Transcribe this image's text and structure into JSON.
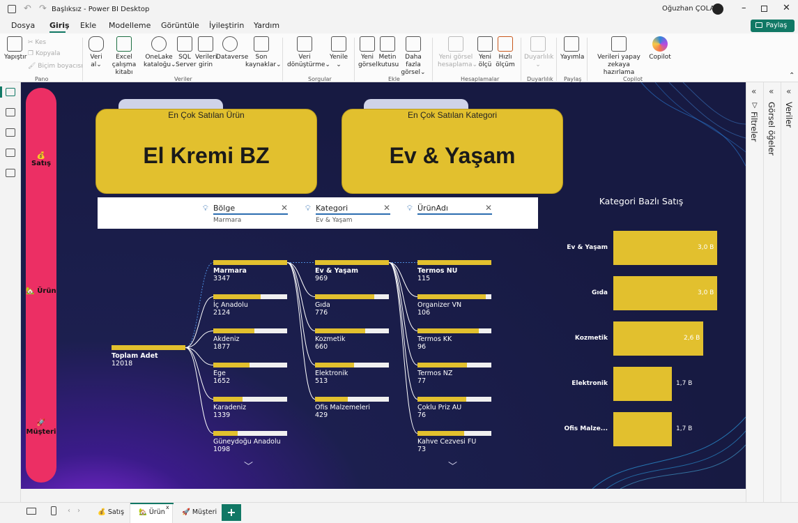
{
  "titlebar": {
    "doc_title": "Başlıksız - Power BI Desktop",
    "user": "Oğuzhan ÇOLAK"
  },
  "menu": {
    "items": [
      "Dosya",
      "Giriş",
      "Ekle",
      "Modelleme",
      "Görüntüle",
      "İyileştirin",
      "Yardım"
    ],
    "active": "Giriş",
    "share": "Paylaş"
  },
  "ribbon": {
    "paste": "Yapıştır",
    "cut": "Kes",
    "copy": "Kopyala",
    "format_painter": "Biçim boyacısı",
    "get_data_1": "Veri",
    "get_data_2": "al",
    "excel_1": "Excel çalışma",
    "excel_2": "kitabı",
    "onelake_1": "OneLake",
    "onelake_2": "kataloğu",
    "sql_1": "SQL",
    "sql_2": "Server",
    "enter_1": "Verileri",
    "enter_2": "girin",
    "dataverse": "Dataverse",
    "recent_1": "Son",
    "recent_2": "kaynaklar",
    "transform_1": "Veri",
    "transform_2": "dönüştürme",
    "refresh": "Yenile",
    "new_visual_1": "Yeni",
    "new_visual_2": "görsel",
    "textbox_1": "Metin",
    "textbox_2": "kutusu",
    "more_visuals_1": "Daha fazla",
    "more_visuals_2": "görsel",
    "new_visual_calc_1": "Yeni görsel",
    "new_visual_calc_2": "hesaplama",
    "new_measure_1": "Yeni",
    "new_measure_2": "ölçü",
    "quick_measure_1": "Hızlı",
    "quick_measure_2": "ölçüm",
    "sensitivity": "Duyarlılık",
    "publish": "Yayımla",
    "copilot_prep_1": "Verileri yapay zekaya",
    "copilot_prep_2": "hazırlama",
    "copilot": "Copilot",
    "groups": {
      "pano": "Pano",
      "veriler": "Veriler",
      "sorgular": "Sorgular",
      "ekle": "Ekle",
      "hesaplamalar": "Hesaplamalar",
      "duyarlilik": "Duyarlılık",
      "paylas": "Paylaş",
      "copilot": "Copilot"
    }
  },
  "side_pages": {
    "satis": "💰 Satış",
    "urun": "🏡 Ürün",
    "musteri": "🚀 Müşteri"
  },
  "cards": {
    "product_label": "En Çok Satılan Ürün",
    "product_value": "El Kremi BZ",
    "category_label": "En Çok Satılan Kategori",
    "category_value": "Ev & Yaşam"
  },
  "slicers": [
    {
      "name": "Bölge",
      "selected": "Marmara"
    },
    {
      "name": "Kategori",
      "selected": "Ev & Yaşam"
    },
    {
      "name": "ÜrünAdı",
      "selected": ""
    }
  ],
  "tree": {
    "root": {
      "name": "Toplam Adet",
      "value": "12018"
    },
    "region": [
      {
        "name": "Marmara",
        "value": "3347",
        "fill": 1.0
      },
      {
        "name": "İç Anadolu",
        "value": "2124",
        "fill": 0.64
      },
      {
        "name": "Akdeniz",
        "value": "1877",
        "fill": 0.56
      },
      {
        "name": "Ege",
        "value": "1652",
        "fill": 0.49
      },
      {
        "name": "Karadeniz",
        "value": "1339",
        "fill": 0.4
      },
      {
        "name": "Güneydoğu Anadolu",
        "value": "1098",
        "fill": 0.33
      }
    ],
    "category": [
      {
        "name": "Ev & Yaşam",
        "value": "969",
        "fill": 1.0
      },
      {
        "name": "Gıda",
        "value": "776",
        "fill": 0.8
      },
      {
        "name": "Kozmetik",
        "value": "660",
        "fill": 0.68
      },
      {
        "name": "Elektronik",
        "value": "513",
        "fill": 0.53
      },
      {
        "name": "Ofis Malzemeleri",
        "value": "429",
        "fill": 0.44
      }
    ],
    "product": [
      {
        "name": "Termos NU",
        "value": "115",
        "fill": 1.0
      },
      {
        "name": "Organizer VN",
        "value": "106",
        "fill": 0.92
      },
      {
        "name": "Termos KK",
        "value": "96",
        "fill": 0.83
      },
      {
        "name": "Termos NZ",
        "value": "77",
        "fill": 0.67
      },
      {
        "name": "Çoklu Priz AU",
        "value": "76",
        "fill": 0.66
      },
      {
        "name": "Kahve Cezvesi FU",
        "value": "73",
        "fill": 0.63
      }
    ]
  },
  "chart_data": {
    "type": "bar",
    "orientation": "horizontal",
    "title": "Kategori Bazlı Satış",
    "categories": [
      "Ev & Yaşam",
      "Gıda",
      "Kozmetik",
      "Elektronik",
      "Ofis Malze..."
    ],
    "values": [
      3.0,
      3.0,
      2.6,
      1.7,
      1.7
    ],
    "value_labels": [
      "3,0 B",
      "3,0 B",
      "2,6 B",
      "1,7 B",
      "1,7 B"
    ],
    "xlim": [
      0,
      3.0
    ],
    "bar_color": "#e2c02e"
  },
  "right_panels": {
    "filters": "Filtreler",
    "visuals": "Görsel öğeler",
    "data": "Veriler"
  },
  "page_tabs": {
    "satis": "💰 Satış",
    "urun": "🏡 Ürün",
    "musteri": "🚀 Müşteri",
    "add": "+"
  }
}
